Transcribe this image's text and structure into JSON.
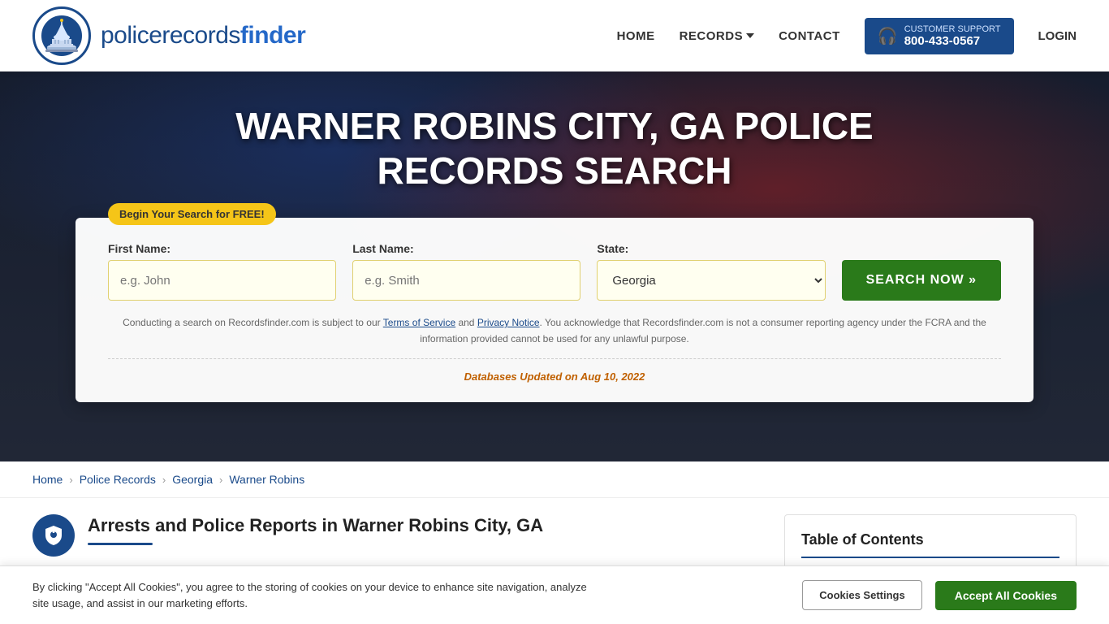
{
  "header": {
    "logo_text_regular": "policerecords",
    "logo_text_bold": "finder",
    "nav": {
      "home": "HOME",
      "records": "RECORDS",
      "contact": "CONTACT",
      "login": "LOGIN"
    },
    "support": {
      "label": "CUSTOMER SUPPORT",
      "phone": "800-433-0567"
    }
  },
  "hero": {
    "title": "WARNER ROBINS CITY, GA POLICE RECORDS SEARCH"
  },
  "search_form": {
    "badge": "Begin Your Search for FREE!",
    "first_name_label": "First Name:",
    "first_name_placeholder": "e.g. John",
    "last_name_label": "Last Name:",
    "last_name_placeholder": "e.g. Smith",
    "state_label": "State:",
    "state_value": "Georgia",
    "search_btn": "SEARCH NOW »",
    "disclaimer": "Conducting a search on Recordsfinder.com is subject to our Terms of Service and Privacy Notice. You acknowledge that Recordsfinder.com is not a consumer reporting agency under the FCRA and the information provided cannot be used for any unlawful purpose.",
    "terms_link": "Terms of Service",
    "privacy_link": "Privacy Notice",
    "db_updated_prefix": "Databases Updated on ",
    "db_updated_date": "Aug 10, 2022"
  },
  "breadcrumb": {
    "items": [
      {
        "label": "Home",
        "href": "#"
      },
      {
        "label": "Police Records",
        "href": "#"
      },
      {
        "label": "Georgia",
        "href": "#"
      },
      {
        "label": "Warner Robins",
        "current": true
      }
    ]
  },
  "article": {
    "title": "Arrests and Police Reports in Warner Robins City, GA",
    "body": ""
  },
  "toc": {
    "title": "Table of Contents"
  },
  "cookie_banner": {
    "text": "By clicking \"Accept All Cookies\", you agree to the storing of cookies on your device to enhance site navigation, analyze site usage, and assist in our marketing efforts.",
    "settings_btn": "Cookies Settings",
    "accept_btn": "Accept All Cookies"
  }
}
